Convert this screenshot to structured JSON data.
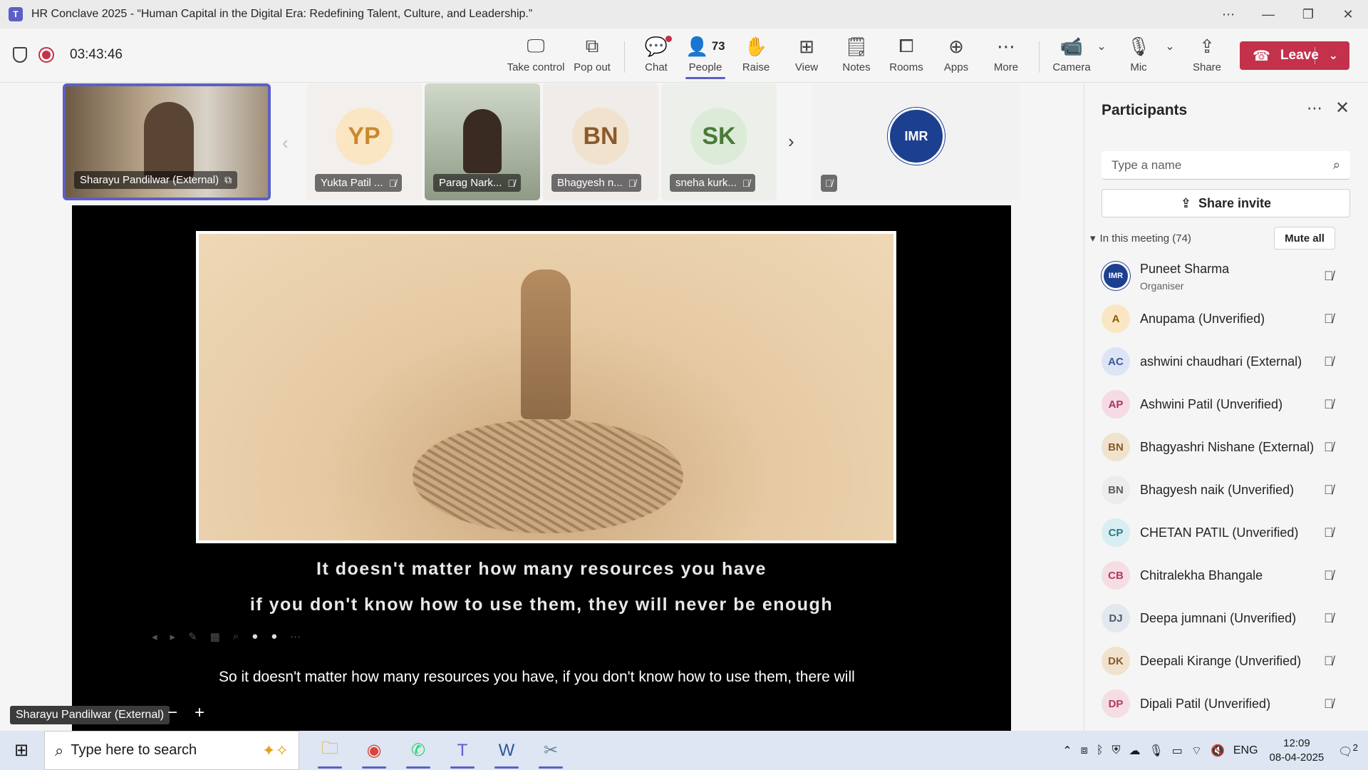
{
  "window": {
    "title": "HR Conclave 2025 - “Human Capital in the Digital Era: Redefining Talent, Culture, and Leadership.”",
    "minimize": "—",
    "restore": "❐",
    "close": "✕"
  },
  "meeting": {
    "timer": "03:43:46",
    "toolbar": {
      "take_control": "Take control",
      "pop_out": "Pop out",
      "chat": "Chat",
      "people": "People",
      "people_count": "73",
      "raise": "Raise",
      "view": "View",
      "notes": "Notes",
      "rooms": "Rooms",
      "apps": "Apps",
      "more": "More",
      "camera": "Camera",
      "mic": "Mic",
      "share": "Share",
      "leave": "Leave"
    }
  },
  "tiles": [
    {
      "name": "Sharayu Pandilwar (External)",
      "initials": ""
    },
    {
      "name": "Yukta Patil ...",
      "initials": "YP"
    },
    {
      "name": "Parag Nark...",
      "initials": ""
    },
    {
      "name": "Bhagyesh n...",
      "initials": "BN"
    },
    {
      "name": "sneha kurk...",
      "initials": "SK"
    },
    {
      "name": "",
      "initials": "IMR"
    }
  ],
  "slide": {
    "line1": "It doesn't matter how many resources you have",
    "line2": "if you don't know how to use them, they will never be enough"
  },
  "caption": {
    "text": "So it doesn't matter how many resources you have, if you don't know how to use them, there will"
  },
  "presenter": {
    "label": "Sharayu Pandilwar (External)"
  },
  "participants": {
    "title": "Participants",
    "search_placeholder": "Type a name",
    "share_invite": "Share invite",
    "section": "In this meeting (74)",
    "mute_all": "Mute all",
    "people": [
      {
        "initials": "IMR",
        "name": "Puneet Sharma",
        "role": "Organiser",
        "avatar_bg": "#1d3f8f",
        "avatar_fg": "#ffffff"
      },
      {
        "initials": "A",
        "name": "Anupama (Unverified)",
        "role": "",
        "avatar_bg": "#fbe6c3",
        "avatar_fg": "#8a5a00"
      },
      {
        "initials": "AC",
        "name": "ashwini chaudhari (External)",
        "role": "",
        "avatar_bg": "#dce4f5",
        "avatar_fg": "#3b5998"
      },
      {
        "initials": "AP",
        "name": "Ashwini Patil (Unverified)",
        "role": "",
        "avatar_bg": "#f5dbe4",
        "avatar_fg": "#a83264"
      },
      {
        "initials": "BN",
        "name": "Bhagyashri Nishane (External)",
        "role": "",
        "avatar_bg": "#f1e2cd",
        "avatar_fg": "#8a5a2b"
      },
      {
        "initials": "BN",
        "name": "Bhagyesh naik (Unverified)",
        "role": "",
        "avatar_bg": "#ececec",
        "avatar_fg": "#5c5c5c"
      },
      {
        "initials": "CP",
        "name": "CHETAN PATIL (Unverified)",
        "role": "",
        "avatar_bg": "#d9eef2",
        "avatar_fg": "#2b7a8a"
      },
      {
        "initials": "CB",
        "name": "Chitralekha Bhangale",
        "role": "",
        "avatar_bg": "#f5dde4",
        "avatar_fg": "#b23a60"
      },
      {
        "initials": "DJ",
        "name": "Deepa jumnani (Unverified)",
        "role": "",
        "avatar_bg": "#e3e8ee",
        "avatar_fg": "#4a5b6e"
      },
      {
        "initials": "DK",
        "name": "Deepali Kirange (Unverified)",
        "role": "",
        "avatar_bg": "#f1e2cd",
        "avatar_fg": "#8a5a2b"
      },
      {
        "initials": "DP",
        "name": "Dipali Patil (Unverified)",
        "role": "",
        "avatar_bg": "#f5dde4",
        "avatar_fg": "#b23a60"
      }
    ]
  },
  "taskbar": {
    "search_placeholder": "Type here to search",
    "language": "ENG",
    "time": "12:09",
    "date": "08-04-2025",
    "notification_count": "2"
  }
}
